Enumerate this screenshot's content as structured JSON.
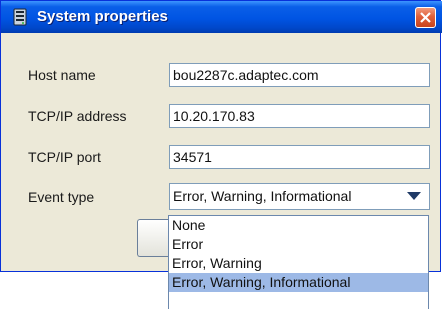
{
  "window": {
    "title": "System properties"
  },
  "form": {
    "host_label": "Host name",
    "host_value": "bou2287c.adaptec.com",
    "ip_label": "TCP/IP address",
    "ip_value": "10.20.170.83",
    "port_label": "TCP/IP port",
    "port_value": "34571",
    "event_label": "Event type",
    "event_value": "Error, Warning, Informational"
  },
  "dropdown": {
    "options": [
      "None",
      "Error",
      "Error, Warning",
      "Error, Warning, Informational"
    ],
    "selected_index": 3
  },
  "icons": {
    "title": "server-icon",
    "close": "close-icon",
    "combo": "chevron-down-icon"
  },
  "colors": {
    "titlebar": "#0054e3",
    "close_button": "#e0603a",
    "window_background": "#ece9d8",
    "selected_option": "#9db9e6"
  }
}
